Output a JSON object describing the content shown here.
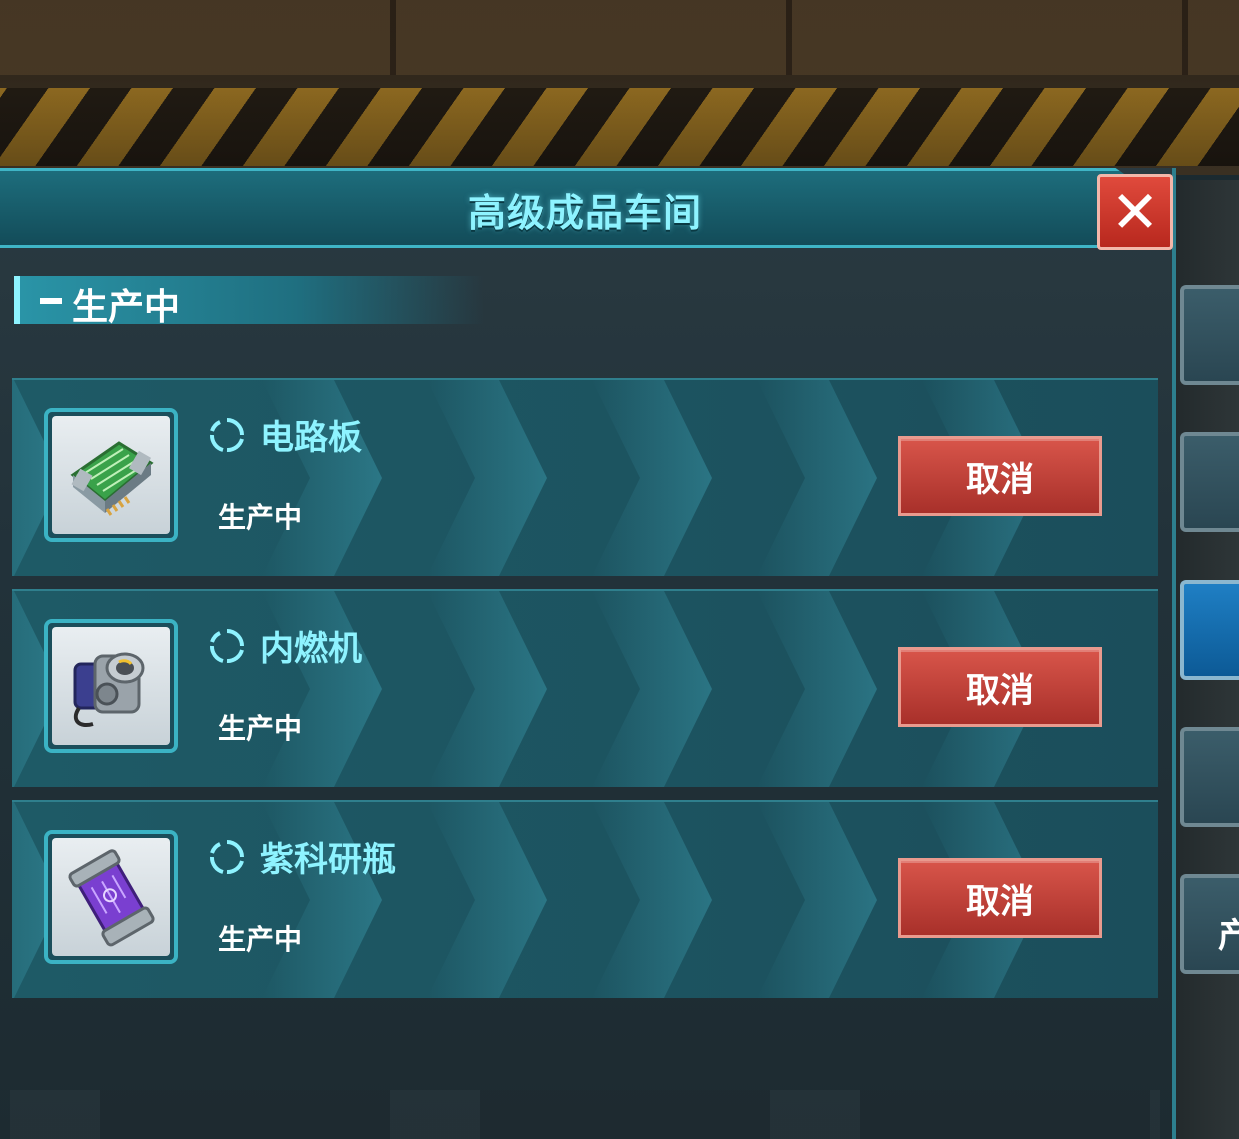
{
  "window": {
    "title": "高级成品车间",
    "close_label": "✕"
  },
  "section": {
    "title": "生产中"
  },
  "items": [
    {
      "name": "电路板",
      "status": "生产中",
      "action": "取消",
      "icon": "circuit-board-icon"
    },
    {
      "name": "内燃机",
      "status": "生产中",
      "action": "取消",
      "icon": "engine-icon"
    },
    {
      "name": "紫科研瓶",
      "status": "生产中",
      "action": "取消",
      "icon": "purple-research-bottle-icon"
    }
  ],
  "side_panel": {
    "partial_label": "产"
  },
  "colors": {
    "accent": "#8ef3ff",
    "cancel": "#c0423a",
    "panel": "#1e5a66"
  }
}
